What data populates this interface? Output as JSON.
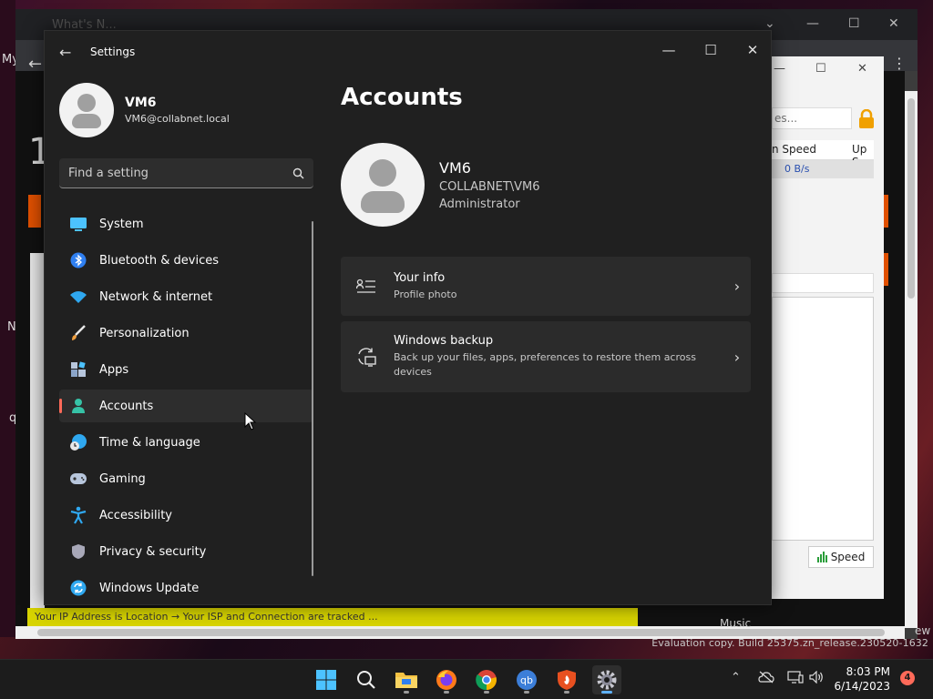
{
  "settings": {
    "app_title": "Settings",
    "profile": {
      "name": "VM6",
      "email": "VM6@collabnet.local"
    },
    "search_placeholder": "Find a setting",
    "nav": [
      {
        "label": "System",
        "icon": "system-icon"
      },
      {
        "label": "Bluetooth & devices",
        "icon": "bluetooth-icon"
      },
      {
        "label": "Network & internet",
        "icon": "network-icon"
      },
      {
        "label": "Personalization",
        "icon": "brush-icon"
      },
      {
        "label": "Apps",
        "icon": "apps-icon"
      },
      {
        "label": "Accounts",
        "icon": "accounts-icon",
        "active": true
      },
      {
        "label": "Time & language",
        "icon": "time-language-icon"
      },
      {
        "label": "Gaming",
        "icon": "gaming-icon"
      },
      {
        "label": "Accessibility",
        "icon": "accessibility-icon"
      },
      {
        "label": "Privacy & security",
        "icon": "shield-icon"
      },
      {
        "label": "Windows Update",
        "icon": "update-icon"
      }
    ],
    "page_title": "Accounts",
    "account": {
      "name": "VM6",
      "domain_user": "COLLABNET\\VM6",
      "role": "Administrator"
    },
    "cards": [
      {
        "title": "Your info",
        "subtitle": "Profile photo",
        "icon": "user-info-icon"
      },
      {
        "title": "Windows backup",
        "subtitle": "Back up your files, apps, preferences to restore them across devices",
        "icon": "backup-icon"
      }
    ]
  },
  "background": {
    "edge_text": {
      "my": "My",
      "n": "N",
      "q": "q",
      "one": "1",
      "ew": "ew"
    },
    "qb": {
      "search": "es...",
      "col_speed": "n Speed",
      "col_up": "Up S",
      "row_value": "0 B/s",
      "speed_button": "Speed"
    },
    "yellow_text": "Your IP Address is Location → Your ISP and Connection are tracked ...",
    "music_label": "Music",
    "tab_text": "What's N..."
  },
  "watermark": "Evaluation copy. Build 25375.zn_release.230520-1632",
  "taskbar": {
    "time": "8:03 PM",
    "date": "6/14/2023",
    "notification_count": "4"
  },
  "colors": {
    "accent": "#ff6a59",
    "window_bg": "#202020",
    "card_bg": "#2b2b2b",
    "taskbar_active": "#5fb2ff"
  }
}
